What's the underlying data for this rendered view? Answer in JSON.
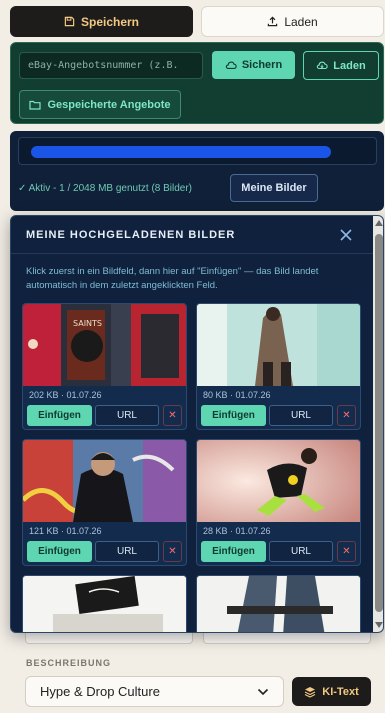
{
  "toolbar": {
    "save_label": "Speichern",
    "load_label": "Laden"
  },
  "ebay": {
    "placeholder": "eBay-Angebotsnummer (z.B.",
    "sichern_label": "Sichern",
    "laden_label": "Laden",
    "saved_offers_label": "Gespeicherte Angebote"
  },
  "account": {
    "status": "✓ Aktiv - 1 / 2048 MB genutzt (8 Bilder)",
    "my_images_label": "Meine Bilder"
  },
  "modal": {
    "title": "MEINE HOCHGELADENEN BILDER",
    "info": "Klick zuerst in ein Bildfeld, dann hier auf \"Einfügen\" — das Bild landet automatisch in dem zuletzt angeklickten Feld.",
    "insert_label": "Einfügen",
    "url_label": "URL",
    "delete_label": "✕",
    "images": [
      {
        "meta": "202 KB · 01.07.26"
      },
      {
        "meta": "80 KB · 01.07.26"
      },
      {
        "meta": "121 KB · 01.07.26"
      },
      {
        "meta": "28 KB · 01.07.26"
      }
    ]
  },
  "description": {
    "label": "BESCHREIBUNG",
    "selected": "Hype & Drop Culture",
    "ki_label": "KI-Text"
  },
  "colors": {
    "accent_green": "#5fd6b2",
    "dark_navy": "#10213d",
    "gold": "#f2c882",
    "danger": "#ff6b6b"
  }
}
